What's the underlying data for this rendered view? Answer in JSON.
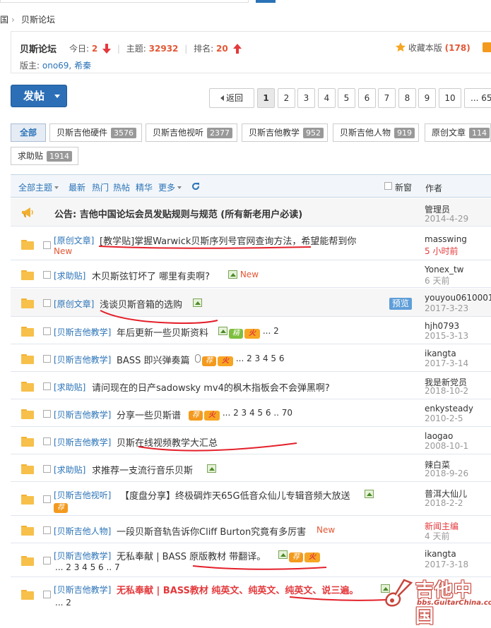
{
  "breadcrumb": {
    "home": "国",
    "sep": "›",
    "current": "贝斯论坛"
  },
  "forum": {
    "name": "贝斯论坛",
    "today_label": "今日:",
    "today_value": "2",
    "topics_label": "主题:",
    "topics_value": "32932",
    "rank_label": "排名:",
    "rank_value": "20",
    "moderators_label": "版主:",
    "moderators": "ono69, 希秦",
    "favorite_label": "收藏本版",
    "favorite_count": "(178)"
  },
  "actions": {
    "post_label": "发帖"
  },
  "pager": {
    "back_label": "返回",
    "pages": [
      "1",
      "2",
      "3",
      "4",
      "5",
      "6",
      "7",
      "8",
      "9",
      "10"
    ],
    "more": "... 65"
  },
  "tabs": [
    {
      "label": "全部",
      "count": ""
    },
    {
      "label": "贝斯吉他硬件",
      "count": "3576"
    },
    {
      "label": "贝斯吉他视听",
      "count": "2377"
    },
    {
      "label": "贝斯吉他教学",
      "count": "952"
    },
    {
      "label": "贝斯吉他人物",
      "count": "919"
    },
    {
      "label": "原创文章",
      "count": "114"
    },
    {
      "label": "求助贴",
      "count": "1914"
    }
  ],
  "filters": {
    "all_topics": "全部主题",
    "latest": "最新",
    "hot": "热门",
    "hot_posts": "热帖",
    "digest": "精华",
    "more": "更多",
    "new_window": "新窗",
    "author": "作者"
  },
  "announcement": {
    "title": "公告: 吉他中国论坛会员发贴规则与规范 (所有新老用户必读)",
    "author": "管理员",
    "date": "2014-4-29"
  },
  "threads": [
    {
      "category": "[原创文章]",
      "title": "[教学贴]掌握Warwick贝斯序列号官网查询方法，希望能帮到你",
      "tag": "New",
      "author": "masswing",
      "date": "5 小时前"
    },
    {
      "category": "[求助贴]",
      "title": "木贝斯弦钉坏了 哪里有卖啊?",
      "tag": "New",
      "author": "Yonex_tw",
      "date": "6 天前"
    },
    {
      "category": "[原创文章]",
      "title": "浅谈贝斯音箱的选购",
      "preview": "预览",
      "author": "youyou06100011",
      "date": "2017-3-23"
    },
    {
      "category": "[贝斯吉他教学]",
      "title": "年后更新一些贝斯资料",
      "pages": "... 2",
      "author": "hjh0793",
      "date": "2015-3-13"
    },
    {
      "category": "[贝斯吉他教学]",
      "title": "BASS 即兴弹奏篇",
      "pages": "... 2 3 4 5 6",
      "author": "ikangta",
      "date": "2017-3-14"
    },
    {
      "category": "[求助贴]",
      "title": "请问现在的日产sadowsky mv4的枫木指板会不会弹黑啊?",
      "author": "我是新党员",
      "date": "2018-10-2"
    },
    {
      "category": "[贝斯吉他教学]",
      "title": "分享一些贝斯谱",
      "pages": "... 2 3 4 5 6 .. 70",
      "author": "enkysteady",
      "date": "2010-2-5"
    },
    {
      "category": "[贝斯吉他教学]",
      "title": "贝斯在线视频教学大汇总",
      "author": "laogao",
      "date": "2008-10-1"
    },
    {
      "category": "[求助贴]",
      "title": "求推荐一支流行音乐贝斯",
      "author": "辣白菜",
      "date": "2018-9-26"
    },
    {
      "category": "[贝斯吉他视听]",
      "title": "【度盘分享】终极碉炸天65G低音众仙儿专辑音频大放送",
      "author": "普洱大仙儿",
      "date": "2018-2-2"
    },
    {
      "category": "[贝斯吉他人物]",
      "title": "一段贝斯音轨告诉你Cliff Burton究竟有多厉害",
      "tag": "New",
      "author": "新闻主编",
      "date": "4 天前"
    },
    {
      "category": "[贝斯吉他教学]",
      "title": "无私奉献 | BASS 原版教材 带翻译。",
      "pages": "... 2 3 4 5 6 .. 7",
      "author": "ikangta",
      "date": "2017-3-18"
    },
    {
      "category": "[贝斯吉他教学]",
      "title": "无私奉献 | BASS教材 纯英文、纯英文、纯英文、说三遍。",
      "pages": "... 2",
      "author": "",
      "date": ""
    }
  ],
  "badges": {
    "tui": "荐",
    "huo": "火",
    "jing": "精"
  },
  "watermark": {
    "cn": "吉他中国",
    "url": "bbs.GuitarChina.com"
  },
  "colors": {
    "accent": "#2b73b7",
    "highlight": "#e45735",
    "annotation_red": "#e4202a"
  }
}
